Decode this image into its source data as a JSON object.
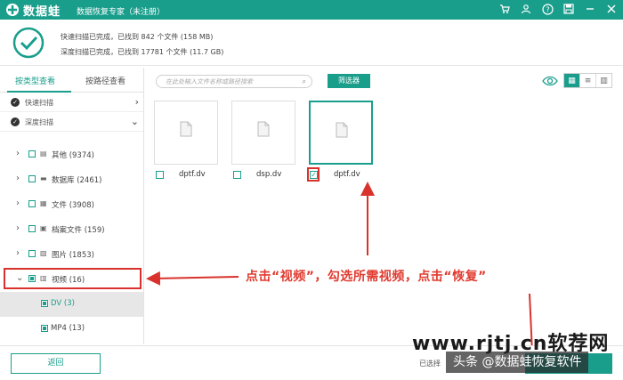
{
  "titlebar": {
    "brand": "数据蛙",
    "product": "数据恢复专家（未注册）",
    "icons": [
      "cart-icon",
      "account-icon",
      "help-icon",
      "save-icon",
      "minimize-icon",
      "close-icon"
    ]
  },
  "status": {
    "quick_scan": "快速扫描已完成，已找到 842 个文件 (158 MB)",
    "deep_scan": "深度扫描已完成，已找到 17781 个文件 (11.7 GB)"
  },
  "sidebar": {
    "tabs": [
      "按类型查看",
      "按路径查看"
    ],
    "scans": [
      {
        "label": "快速扫描",
        "arrow": "›"
      },
      {
        "label": "深度扫描",
        "arrow": "⌄"
      }
    ],
    "tree": [
      {
        "label": "其他 (9374)",
        "icon": "other-icon"
      },
      {
        "label": "数据库 (2461)",
        "icon": "database-icon"
      },
      {
        "label": "文件 (3908)",
        "icon": "file-icon"
      },
      {
        "label": "档案文件 (159)",
        "icon": "archive-icon"
      },
      {
        "label": "图片 (1853)",
        "icon": "image-icon"
      },
      {
        "label": "视频 (16)",
        "icon": "video-icon"
      },
      {
        "label": "DV (3)",
        "icon": ""
      },
      {
        "label": "MP4 (13)",
        "icon": ""
      }
    ]
  },
  "toolbar": {
    "search_placeholder": "在此处输入文件名称或路径搜索",
    "filter_label": "筛选器"
  },
  "files": [
    {
      "name": "dptf.dv",
      "checked": false
    },
    {
      "name": "dsp.dv",
      "checked": false
    },
    {
      "name": "dptf.dv",
      "checked": true
    }
  ],
  "annotation": "点击“视频”，勾选所需视频，点击“恢复”",
  "bottom": {
    "back_label": "返回",
    "selected_label": "已选择"
  },
  "watermark": {
    "site": "www.rjtj.cn软荐网",
    "account": "头条 @数据蛙恢复软件"
  },
  "colors": {
    "accent": "#1a9e8c",
    "annotation": "#e03a2f"
  }
}
